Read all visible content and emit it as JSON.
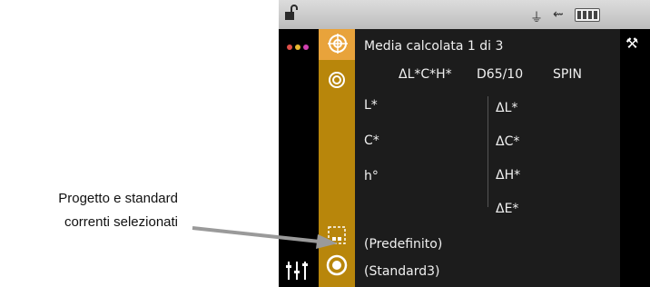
{
  "header": {
    "title": "Media calcolata 1 di 3",
    "mode": "ΔL*C*H*",
    "illuminant": "D65/10",
    "spec": "SPIN"
  },
  "readings": {
    "left_labels": [
      "L*",
      "C*",
      "h°"
    ],
    "right_labels": [
      "ΔL*",
      "ΔC*",
      "ΔH*",
      "ΔE*"
    ]
  },
  "selection": {
    "project": "(Predefinito)",
    "standard": "(Standard3)"
  },
  "annotation": {
    "line1": "Progetto e standard",
    "line2": "correnti selezionati"
  },
  "icons": [
    "lock-open-icon",
    "usb-icon",
    "battery-icon",
    "color-dots-icon",
    "target-icon",
    "ring-icon",
    "project-icon",
    "standard-icon",
    "sliders-icon",
    "tools-icon"
  ],
  "colors": {
    "gold": "#b8860b",
    "gold_light": "#e8a33b",
    "screen_bg": "#1c1c1c"
  }
}
